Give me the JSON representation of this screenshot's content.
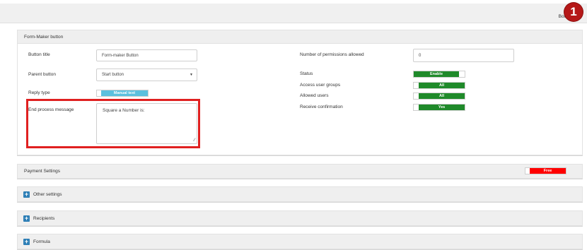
{
  "header": {
    "breadcrumb": "Bot butt",
    "step_number": "1"
  },
  "form_panel": {
    "title": "Form-Maker button",
    "button_title": {
      "label": "Button title",
      "value": "Form-maker Button"
    },
    "parent_button": {
      "label": "Parent button",
      "value": "Start button"
    },
    "reply_type": {
      "label": "Reply type",
      "value": "Manual text"
    },
    "end_process": {
      "label": "End process message",
      "value": "Square a Number is:"
    },
    "permissions": {
      "label": "Number of permissions allowed",
      "value": "0"
    },
    "status": {
      "label": "Status",
      "value": "Enable"
    },
    "access_groups": {
      "label": "Access user groups",
      "value": "All"
    },
    "allowed_users": {
      "label": "Allowed users",
      "value": "All"
    },
    "receive_confirmation": {
      "label": "Receive confirmation",
      "value": "Yes"
    }
  },
  "payment_panel": {
    "title": "Payment Settings",
    "value": "Free"
  },
  "sections": {
    "other": "Other settings",
    "recipients": "Recipients",
    "formula": "Formula"
  },
  "colors": {
    "green": "#1f8a2a",
    "blue": "#5bc0de",
    "red": "#ff0000",
    "highlight": "#e02020",
    "badge": "#b51818"
  }
}
